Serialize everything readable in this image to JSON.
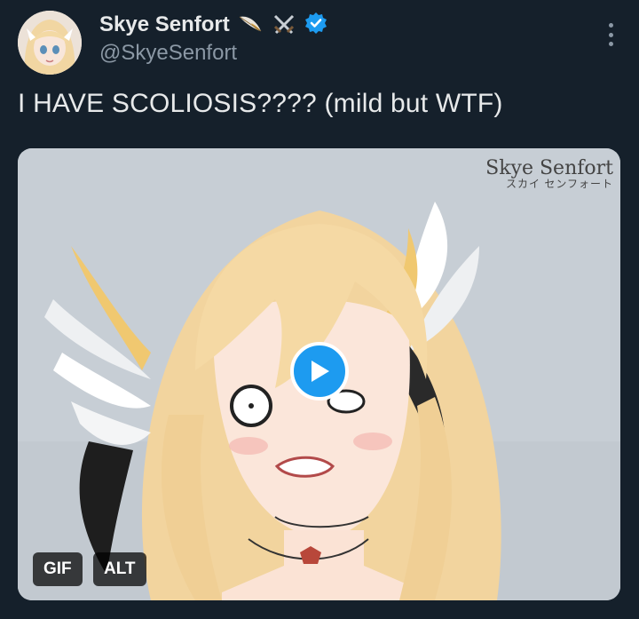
{
  "author": {
    "display_name": "Skye Senfort",
    "handle": "@SkyeSenfort",
    "name_emojis": [
      "feather-icon",
      "crossed-swords-icon"
    ],
    "verified_color": "#1d9bf0"
  },
  "tweet": {
    "text": "I HAVE SCOLIOSIS???? (mild but WTF)"
  },
  "media": {
    "watermark_line1": "Skye Senfort",
    "watermark_line2": "スカイ センフォート",
    "gif_badge": "GIF",
    "alt_badge": "ALT"
  },
  "colors": {
    "background": "#15202b",
    "text_primary": "#e7e9ea",
    "text_secondary": "#8b98a5",
    "accent": "#1d9bf0"
  }
}
